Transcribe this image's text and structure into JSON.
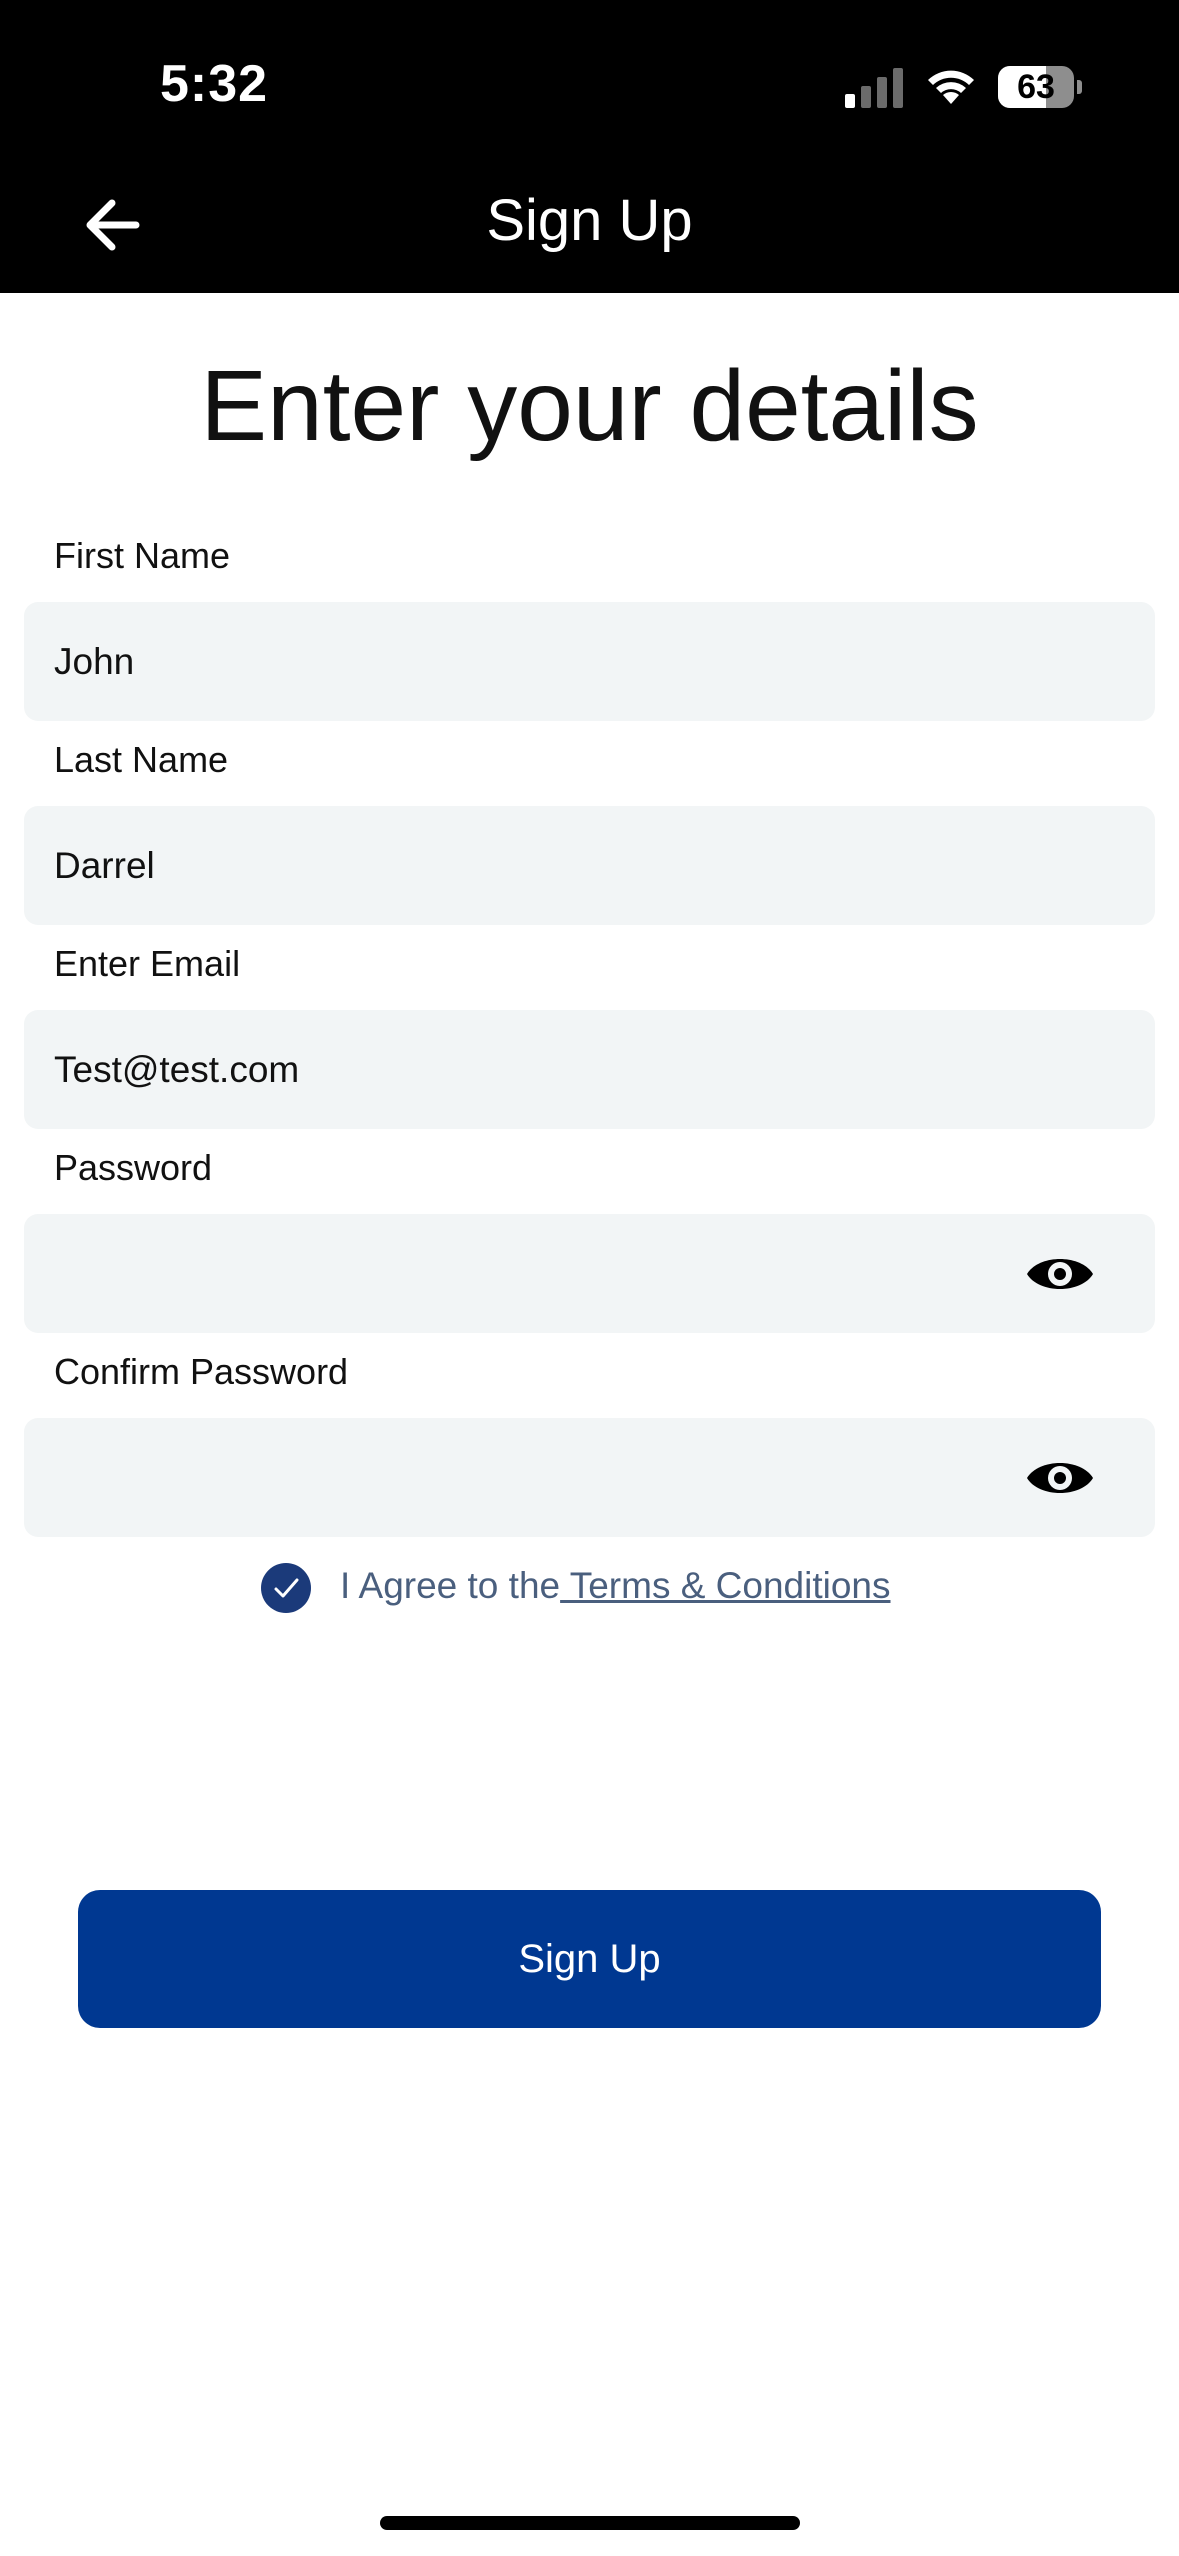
{
  "status_bar": {
    "time": "5:32",
    "battery_percent": "63",
    "battery_level": 0.63,
    "signal_bars_active": 1,
    "icons": [
      "signal-icon",
      "wifi-icon",
      "battery-icon"
    ]
  },
  "header": {
    "title": "Sign Up",
    "back_icon": "arrow-left-icon"
  },
  "page": {
    "heading": "Enter your details"
  },
  "form": {
    "first_name": {
      "label": "First Name",
      "value": "John"
    },
    "last_name": {
      "label": "Last Name",
      "value": "Darrel"
    },
    "email": {
      "label": "Enter Email",
      "value": "Test@test.com"
    },
    "password": {
      "label": "Password",
      "value": "",
      "toggle_icon": "eye-icon"
    },
    "confirm_password": {
      "label": "Confirm Password",
      "value": "",
      "toggle_icon": "eye-icon"
    }
  },
  "terms": {
    "checked": true,
    "prefix": "I Agree to the",
    "link_text": " Terms & Conditions"
  },
  "actions": {
    "signup_label": "Sign Up"
  },
  "colors": {
    "header_bg": "#000000",
    "field_bg": "#f2f5f6",
    "primary_button": "#003891",
    "checkbox": "#1b3a7a",
    "terms_text": "#4a5f7e"
  }
}
